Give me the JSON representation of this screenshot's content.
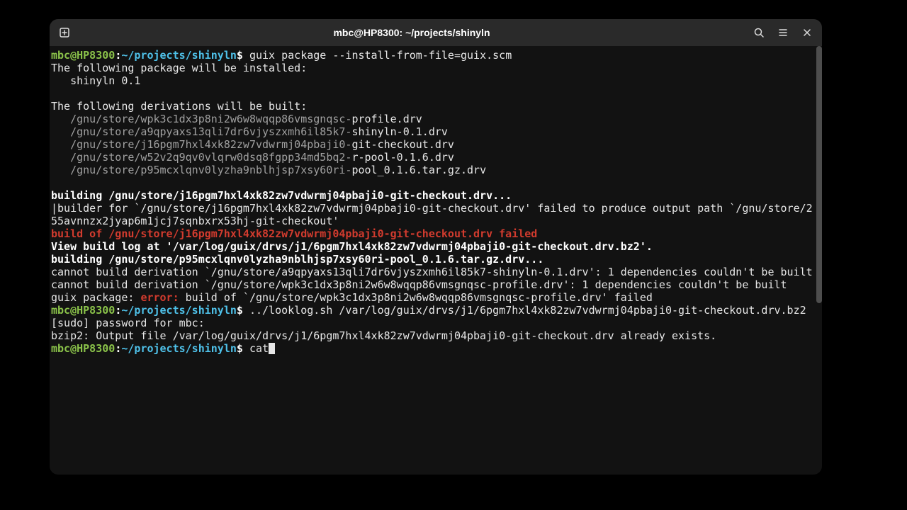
{
  "title": "mbc@HP8300: ~/projects/shinyln",
  "prompt": {
    "userhost": "mbc@HP8300",
    "colon": ":",
    "path": "~/projects/shinyln",
    "sigil": "$"
  },
  "cmd1": "guix package --install-from-file=guix.scm",
  "install_header": "The following package will be installed:",
  "install_pkg": "   shinyln 0.1",
  "deriv_header": "The following derivations will be built:",
  "deriv_rows": [
    {
      "hash": "   /gnu/store/wpk3c1dx3p8ni2w6w8wqqp86vmsgnqsc-",
      "name": "profile.drv"
    },
    {
      "hash": "   /gnu/store/a9qpyaxs13qli7dr6vjyszxmh6il85k7-",
      "name": "shinyln-0.1.drv"
    },
    {
      "hash": "   /gnu/store/j16pgm7hxl4xk82zw7vdwrmj04pbaji0-",
      "name": "git-checkout.drv"
    },
    {
      "hash": "   /gnu/store/w52v2q9qv0vlqrw0dsq8fgpp34md5bq2-",
      "name": "r-pool-0.1.6.drv"
    },
    {
      "hash": "   /gnu/store/p95mcxlqnv0lyzha9nblhjsp7xsy60ri-",
      "name": "pool_0.1.6.tar.gz.drv"
    }
  ],
  "build1": "building /gnu/store/j16pgm7hxl4xk82zw7vdwrmj04pbaji0-git-checkout.drv...",
  "builder_fail1": "|builder for `/gnu/store/j16pgm7hxl4xk82zw7vdwrmj04pbaji0-git-checkout.drv' failed to produce output path `/gnu/store/2",
  "builder_fail2": "55avnnzx2jyap6m1jcj7sqnbxrx53hj-git-checkout'",
  "build_failed_red": "build of /gnu/store/j16pgm7hxl4xk82zw7vdwrmj04pbaji0-git-checkout.drv failed",
  "viewlog": "View build log at '/var/log/guix/drvs/j1/6pgm7hxl4xk82zw7vdwrmj04pbaji0-git-checkout.drv.bz2'.",
  "build2": "building /gnu/store/p95mcxlqnv0lyzha9nblhjsp7xsy60ri-pool_0.1.6.tar.gz.drv...",
  "cannot1": "cannot build derivation `/gnu/store/a9qpyaxs13qli7dr6vjyszxmh6il85k7-shinyln-0.1.drv': 1 dependencies couldn't be built",
  "cannot2": "cannot build derivation `/gnu/store/wpk3c1dx3p8ni2w6w8wqqp86vmsgnqsc-profile.drv': 1 dependencies couldn't be built",
  "guix_pkg_err_pre": "guix package: ",
  "guix_pkg_err_tag": "error:",
  "guix_pkg_err_post": " build of `/gnu/store/wpk3c1dx3p8ni2w6w8wqqp86vmsgnqsc-profile.drv' failed",
  "cmd2": "../looklog.sh /var/log/guix/drvs/j1/6pgm7hxl4xk82zw7vdwrmj04pbaji0-git-checkout.drv.bz2",
  "sudo_prompt": "[sudo] password for mbc:",
  "bzip2_line": "bzip2: Output file /var/log/guix/drvs/j1/6pgm7hxl4xk82zw7vdwrmj04pbaji0-git-checkout.drv already exists.",
  "cmd3": "cat"
}
